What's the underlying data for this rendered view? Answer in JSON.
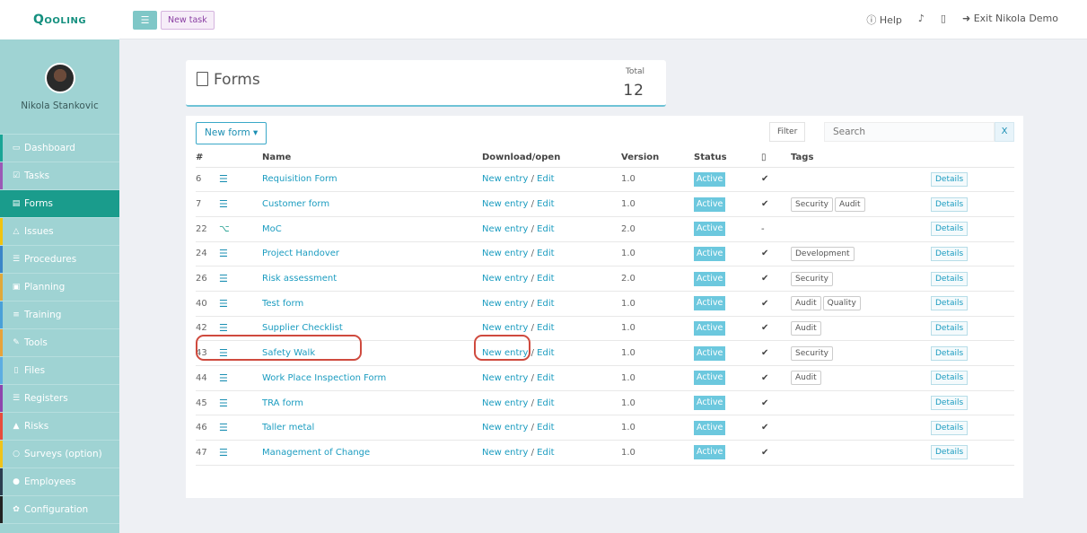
{
  "brand": {
    "logo": "Qooling"
  },
  "user": {
    "name": "Nikola Stankovic"
  },
  "sidebar": {
    "items": [
      {
        "label": "Dashboard",
        "icon": "monitor-icon",
        "glyph": "▭",
        "accent": "#1aa596",
        "active": false
      },
      {
        "label": "Tasks",
        "icon": "check-square-icon",
        "glyph": "☑",
        "accent": "#9b59b6",
        "active": false
      },
      {
        "label": "Forms",
        "icon": "document-icon",
        "glyph": "▤",
        "accent": "#1a9c8c",
        "active": true
      },
      {
        "label": "Issues",
        "icon": "bell-icon",
        "glyph": "△",
        "accent": "#f1c40f",
        "active": false
      },
      {
        "label": "Procedures",
        "icon": "list-icon",
        "glyph": "☰",
        "accent": "#3a86c8",
        "active": false
      },
      {
        "label": "Planning",
        "icon": "calendar-icon",
        "glyph": "▣",
        "accent": "#e0a93a",
        "active": false
      },
      {
        "label": "Training",
        "icon": "graduation-icon",
        "glyph": "≡",
        "accent": "#4aa0d8",
        "active": false
      },
      {
        "label": "Tools",
        "icon": "wrench-icon",
        "glyph": "✎",
        "accent": "#e8a33a",
        "active": false
      },
      {
        "label": "Files",
        "icon": "file-icon",
        "glyph": "▯",
        "accent": "#5dade2",
        "active": false
      },
      {
        "label": "Registers",
        "icon": "registers-icon",
        "glyph": "☰",
        "accent": "#8e44ad",
        "active": false
      },
      {
        "label": "Risks",
        "icon": "warning-icon",
        "glyph": "▲",
        "accent": "#e74c3c",
        "active": false
      },
      {
        "label": "Surveys (option)",
        "icon": "chat-icon",
        "glyph": "○",
        "accent": "#f0c419",
        "active": false
      },
      {
        "label": "Employees",
        "icon": "users-icon",
        "glyph": "●",
        "accent": "#2c3e50",
        "active": false
      },
      {
        "label": "Configuration",
        "icon": "gear-icon",
        "glyph": "✿",
        "accent": "#222222",
        "active": false
      }
    ]
  },
  "topbar": {
    "new_task": "New task",
    "help": "Help",
    "exit": "Exit Nikola Demo"
  },
  "header": {
    "title": "Forms",
    "total_label": "Total",
    "total_value": "12"
  },
  "toolbar": {
    "new_form": "New form ▾",
    "filter": "Filter",
    "search_placeholder": "Search",
    "clear": "X"
  },
  "table": {
    "columns": [
      "#",
      "",
      "Name",
      "Download/open",
      "Version",
      "Status",
      "",
      "Tags",
      ""
    ],
    "rows": [
      {
        "id": "6",
        "icon": "list",
        "name": "Requisition Form",
        "new_entry": "New entry",
        "edit": "Edit",
        "version": "1.0",
        "status": "Active",
        "mark": "✔",
        "tags": [],
        "details": "Details"
      },
      {
        "id": "7",
        "icon": "list",
        "name": "Customer form",
        "new_entry": "New entry",
        "edit": "Edit",
        "version": "1.0",
        "status": "Active",
        "mark": "✔",
        "tags": [
          "Security",
          "Audit"
        ],
        "details": "Details"
      },
      {
        "id": "22",
        "icon": "moc",
        "name": "MoC",
        "new_entry": "New entry",
        "edit": "Edit",
        "version": "2.0",
        "status": "Active",
        "mark": "-",
        "tags": [],
        "details": "Details"
      },
      {
        "id": "24",
        "icon": "list",
        "name": "Project Handover",
        "new_entry": "New entry",
        "edit": "Edit",
        "version": "1.0",
        "status": "Active",
        "mark": "✔",
        "tags": [
          "Development"
        ],
        "details": "Details"
      },
      {
        "id": "26",
        "icon": "list",
        "name": "Risk assessment",
        "new_entry": "New entry",
        "edit": "Edit",
        "version": "2.0",
        "status": "Active",
        "mark": "✔",
        "tags": [
          "Security"
        ],
        "details": "Details"
      },
      {
        "id": "40",
        "icon": "list",
        "name": "Test form",
        "new_entry": "New entry",
        "edit": "Edit",
        "version": "1.0",
        "status": "Active",
        "mark": "✔",
        "tags": [
          "Audit",
          "Quality"
        ],
        "details": "Details"
      },
      {
        "id": "42",
        "icon": "list",
        "name": "Supplier Checklist",
        "new_entry": "New entry",
        "edit": "Edit",
        "version": "1.0",
        "status": "Active",
        "mark": "✔",
        "tags": [
          "Audit"
        ],
        "details": "Details"
      },
      {
        "id": "43",
        "icon": "list",
        "name": "Safety Walk",
        "new_entry": "New entry",
        "edit": "Edit",
        "version": "1.0",
        "status": "Active",
        "mark": "✔",
        "tags": [
          "Security"
        ],
        "details": "Details"
      },
      {
        "id": "44",
        "icon": "list",
        "name": "Work Place Inspection Form",
        "new_entry": "New entry",
        "edit": "Edit",
        "version": "1.0",
        "status": "Active",
        "mark": "✔",
        "tags": [
          "Audit"
        ],
        "details": "Details"
      },
      {
        "id": "45",
        "icon": "list",
        "name": "TRA form",
        "new_entry": "New entry",
        "edit": "Edit",
        "version": "1.0",
        "status": "Active",
        "mark": "✔",
        "tags": [],
        "details": "Details"
      },
      {
        "id": "46",
        "icon": "list",
        "name": "Taller metal",
        "new_entry": "New entry",
        "edit": "Edit",
        "version": "1.0",
        "status": "Active",
        "mark": "✔",
        "tags": [],
        "details": "Details"
      },
      {
        "id": "47",
        "icon": "list",
        "name": "Management of Change",
        "new_entry": "New entry",
        "edit": "Edit",
        "version": "1.0",
        "status": "Active",
        "mark": "✔",
        "tags": [],
        "details": "Details"
      }
    ]
  },
  "colors": {
    "accent": "#1a9c8c",
    "link": "#1b9cc0",
    "status": "#6cc8de",
    "highlight": "#cf4a3e"
  }
}
